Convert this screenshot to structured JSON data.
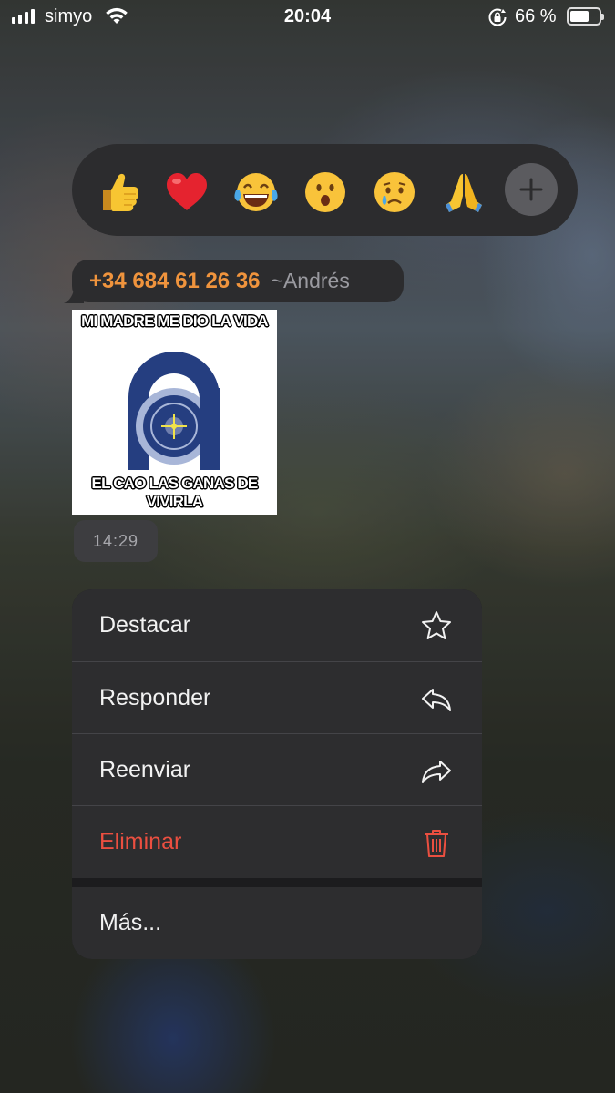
{
  "status_bar": {
    "carrier": "simyo",
    "time": "20:04",
    "battery_percent": "66 %",
    "battery_level": 0.66
  },
  "reactions": {
    "emojis": [
      "thumbs-up",
      "red-heart",
      "tears-of-joy",
      "surprised-face",
      "crying-face",
      "folded-hands"
    ],
    "more_icon": "plus-icon"
  },
  "message": {
    "sender_phone": "+34 684 61 26 36",
    "sender_alias": "~Andrés",
    "meme_top_text": "MI MADRE ME DIO LA VIDA",
    "meme_bottom_text": "EL CAO LAS GANAS DE VIVIRLA",
    "time": "14:29"
  },
  "menu": {
    "items": [
      {
        "label": "Destacar",
        "icon": "star-icon"
      },
      {
        "label": "Responder",
        "icon": "reply-icon"
      },
      {
        "label": "Reenviar",
        "icon": "forward-icon"
      },
      {
        "label": "Eliminar",
        "icon": "trash-icon"
      },
      {
        "label": "Más..."
      }
    ]
  },
  "colors": {
    "accent_orange": "#f0943d",
    "danger": "#eb4f40",
    "menu_bg": "#2d2d2f"
  }
}
